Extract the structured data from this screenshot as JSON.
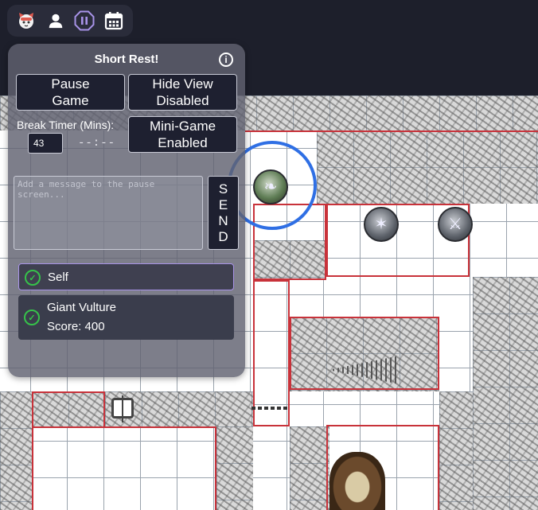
{
  "toolbar": {
    "icons": [
      "cat-face-icon",
      "user-icon",
      "pause-icon",
      "calendar-icon"
    ]
  },
  "panel": {
    "title": "Short Rest!",
    "pause_button": "Pause\nGame",
    "hide_view_button": "Hide View\nDisabled",
    "mini_game_button": "Mini-Game\nEnabled",
    "break_timer_label": "Break Timer (Mins):",
    "break_timer_value": "43",
    "timer_display": "--:--",
    "message_placeholder": "Add a message to the pause screen...",
    "send_button_letters": [
      "S",
      "E",
      "N",
      "D"
    ]
  },
  "players": [
    {
      "name": "Self",
      "checked": true
    },
    {
      "name": "Giant Vulture",
      "score_text": "Score: 400",
      "checked": true
    }
  ],
  "colors": {
    "panel_bg": "#606270",
    "button_bg": "#1e2030",
    "check_green": "#36c24a",
    "wall_red": "#c8323a",
    "selection_blue": "#2f6fe4",
    "self_border": "#a893e8"
  }
}
